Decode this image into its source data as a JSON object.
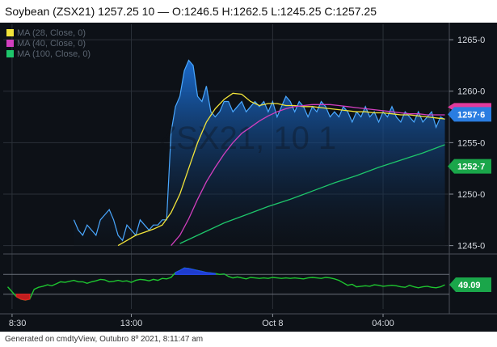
{
  "header": {
    "title": "Soybean (ZSX21) 1257.25 10 — O:1246.5 H:1262.5 L:1245.25 C:1257.25"
  },
  "footer": {
    "text": "Generated on cmdtyView, Outubro 8º 2021, 8:11:47 am"
  },
  "watermark": "ZSX21, 10 1",
  "colors": {
    "background": "#0d1117",
    "price_line": "#4aa8ff",
    "area_top": "#1a6fd6",
    "ma_short": "#f2e43a",
    "ma_mid": "#d23fbf",
    "ma_long": "#1ec66b",
    "lower_line": "#1ec630",
    "lower_high": "#2244ee",
    "lower_low": "#e02020",
    "last_price_tag": "#2a7de1",
    "ma_tag": "#1aa64a",
    "pink_tag": "#e23a9c"
  },
  "price_tag": "1257·6",
  "ma_tag": "1252·7",
  "lower_tag": "49.09",
  "chart_data": [
    {
      "type": "area",
      "title": "Soybean (ZSX21) 1257.25 10",
      "ylim": [
        1244.5,
        1266.5
      ],
      "y_ticks": [
        1245,
        1250,
        1255,
        1260,
        1265
      ],
      "y_tick_labels": [
        "1245-0",
        "1250-0",
        "1255-0",
        "1260-0",
        "1265-0"
      ],
      "x_tick_labels": [
        "8:30",
        "13:00",
        "Oct 8",
        "04:00"
      ],
      "x_tick_positions": [
        2,
        29,
        61,
        86
      ],
      "legend": [
        "MA (28, Close, 0)",
        "MA (40, Close, 0)",
        "MA (100, Close, 0)"
      ],
      "legend_placement": "top-left",
      "series": [
        {
          "name": "Soybean (ZSX21)",
          "x": [
            16,
            17,
            18,
            19,
            20,
            21,
            22,
            23,
            24,
            25,
            26,
            27,
            28,
            29,
            30,
            31,
            32,
            33,
            34,
            35,
            36,
            37,
            38,
            39,
            40,
            41,
            42,
            43,
            44,
            45,
            46,
            47,
            48,
            49,
            50,
            51,
            52,
            53,
            54,
            55,
            56,
            57,
            58,
            59,
            60,
            61,
            62,
            63,
            64,
            65,
            66,
            67,
            68,
            69,
            70,
            71,
            72,
            73,
            74,
            75,
            76,
            77,
            78,
            79,
            80,
            81,
            82,
            83,
            84,
            85,
            86,
            87,
            88,
            89,
            90,
            91,
            92,
            93,
            94,
            95,
            96,
            97,
            98,
            99,
            100
          ],
          "y": [
            1247.5,
            1246.5,
            1246.0,
            1247.0,
            1246.5,
            1246.0,
            1247.5,
            1248.0,
            1248.5,
            1247.5,
            1246.0,
            1245.5,
            1247.0,
            1246.5,
            1246.0,
            1247.5,
            1247.0,
            1246.5,
            1247.0,
            1247.0,
            1247.5,
            1247.5,
            1256.0,
            1258.5,
            1259.5,
            1262.0,
            1263.0,
            1262.5,
            1259.5,
            1259.0,
            1260.5,
            1258.0,
            1257.5,
            1258.0,
            1259.0,
            1259.0,
            1258.0,
            1258.5,
            1259.0,
            1258.0,
            1258.5,
            1259.0,
            1258.5,
            1259.0,
            1258.0,
            1259.0,
            1257.5,
            1258.5,
            1259.5,
            1259.0,
            1258.0,
            1259.0,
            1258.5,
            1257.5,
            1258.5,
            1258.0,
            1259.0,
            1258.5,
            1257.5,
            1258.0,
            1257.5,
            1258.5,
            1258.0,
            1257.0,
            1258.0,
            1257.5,
            1258.5,
            1257.5,
            1258.0,
            1257.0,
            1258.0,
            1257.5,
            1258.5,
            1257.5,
            1257.0,
            1258.0,
            1257.5,
            1257.0,
            1258.0,
            1257.0,
            1257.5,
            1258.0,
            1256.5,
            1257.5,
            1257.25
          ]
        },
        {
          "name": "MA (28, Close, 0)",
          "x": [
            26,
            28,
            30,
            32,
            34,
            36,
            38,
            40,
            42,
            44,
            46,
            48,
            50,
            52,
            54,
            56,
            58,
            60,
            62,
            64,
            66,
            68,
            70,
            72,
            74,
            76,
            78,
            80,
            82,
            84,
            86,
            88,
            90,
            92,
            94,
            96,
            98,
            100
          ],
          "y": [
            1245.0,
            1245.5,
            1246.0,
            1246.3,
            1246.6,
            1247.0,
            1248.2,
            1250.0,
            1252.5,
            1255.0,
            1257.0,
            1258.3,
            1259.2,
            1259.8,
            1259.7,
            1259.0,
            1258.6,
            1258.8,
            1258.8,
            1258.6,
            1258.6,
            1258.5,
            1258.5,
            1258.4,
            1258.3,
            1258.2,
            1258.1,
            1258.0,
            1258.0,
            1257.9,
            1257.9,
            1257.8,
            1257.7,
            1257.7,
            1257.6,
            1257.5,
            1257.4,
            1257.3
          ]
        },
        {
          "name": "MA (40, Close, 0)",
          "x": [
            38,
            40,
            42,
            44,
            46,
            48,
            50,
            52,
            54,
            56,
            58,
            60,
            62,
            64,
            66,
            68,
            70,
            72,
            74,
            76,
            78,
            80,
            82,
            84,
            86,
            88,
            90,
            92,
            94,
            96,
            98,
            100
          ],
          "y": [
            1245.0,
            1246.0,
            1247.6,
            1249.5,
            1251.2,
            1252.6,
            1253.9,
            1255.0,
            1255.9,
            1256.5,
            1257.1,
            1257.6,
            1258.0,
            1258.3,
            1258.5,
            1258.6,
            1258.7,
            1258.7,
            1258.7,
            1258.6,
            1258.5,
            1258.4,
            1258.3,
            1258.2,
            1258.1,
            1258.0,
            1257.9,
            1257.8,
            1257.8,
            1257.7,
            1257.7,
            1257.7
          ]
        },
        {
          "name": "MA (100, Close, 0)",
          "x": [
            40,
            45,
            50,
            55,
            60,
            65,
            70,
            75,
            80,
            85,
            90,
            95,
            100
          ],
          "y": [
            1245.2,
            1246.2,
            1247.2,
            1248.0,
            1248.8,
            1249.5,
            1250.3,
            1251.1,
            1251.8,
            1252.6,
            1253.3,
            1254.0,
            1254.8
          ]
        }
      ]
    },
    {
      "type": "line",
      "title": "",
      "ylim": [
        0,
        100
      ],
      "y_levels": [
        70,
        30
      ],
      "series": [
        {
          "name": "",
          "x": [
            1,
            3,
            4,
            5,
            6,
            7,
            8,
            9,
            10,
            11,
            12,
            13,
            14,
            15,
            16,
            17,
            18,
            19,
            20,
            21,
            22,
            23,
            24,
            25,
            26,
            27,
            28,
            29,
            30,
            31,
            32,
            33,
            34,
            35,
            36,
            37,
            38,
            39,
            40,
            41,
            42,
            43,
            44,
            45,
            46,
            47,
            48,
            49,
            50,
            51,
            52,
            53,
            54,
            55,
            56,
            57,
            58,
            59,
            60,
            61,
            62,
            63,
            64,
            65,
            66,
            67,
            68,
            69,
            70,
            71,
            72,
            73,
            74,
            75,
            76,
            77,
            78,
            79,
            80,
            81,
            82,
            83,
            84,
            85,
            86,
            87,
            88,
            89,
            90,
            91,
            92,
            93,
            94,
            95,
            96,
            97,
            98,
            99,
            100
          ],
          "y": [
            45,
            25,
            20,
            18,
            20,
            40,
            44,
            46,
            49,
            47,
            51,
            55,
            54,
            56,
            58,
            55,
            55,
            52,
            55,
            57,
            60,
            59,
            55,
            56,
            58,
            56,
            57,
            54,
            58,
            60,
            59,
            57,
            60,
            58,
            62,
            61,
            64,
            74,
            78,
            83,
            82,
            80,
            78,
            76,
            74,
            73,
            72,
            70,
            71,
            66,
            63,
            65,
            63,
            61,
            64,
            63,
            62,
            63,
            62,
            64,
            63,
            62,
            63,
            62,
            63,
            62,
            61,
            63,
            64,
            63,
            62,
            64,
            63,
            61,
            58,
            53,
            48,
            50,
            45,
            46,
            47,
            46,
            49,
            48,
            46,
            47,
            48,
            47,
            45,
            44,
            48,
            45,
            43,
            45,
            46,
            44,
            43,
            45,
            49.09
          ]
        }
      ]
    }
  ]
}
